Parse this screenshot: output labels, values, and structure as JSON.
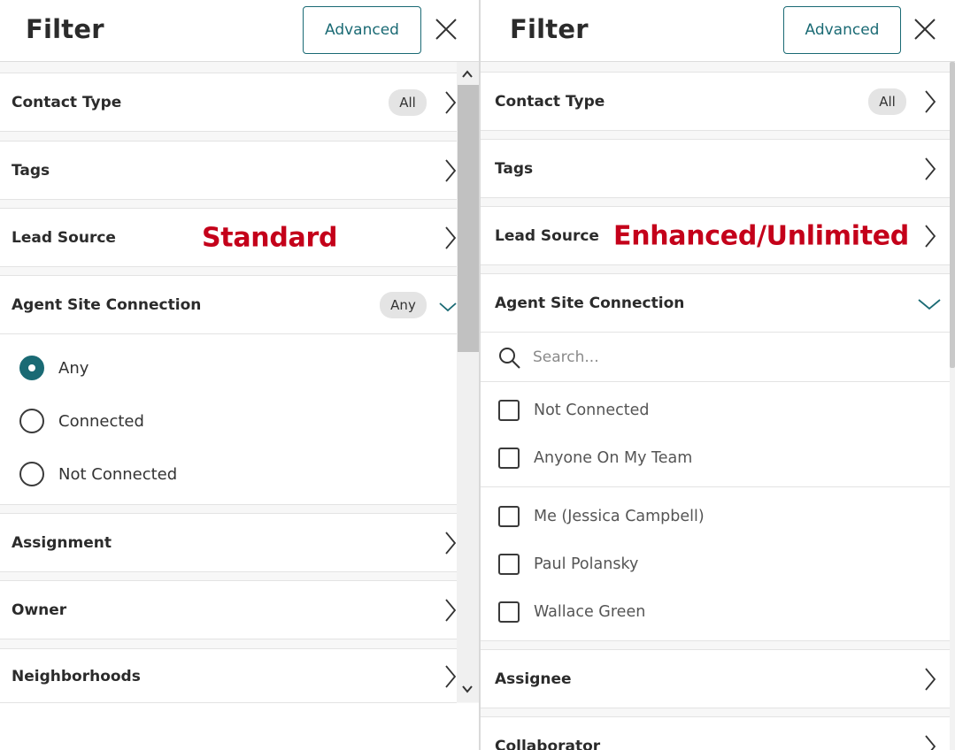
{
  "left_panel": {
    "title": "Filter",
    "advanced_label": "Advanced",
    "annotation": "Standard",
    "sections": {
      "contact_type": {
        "label": "Contact Type",
        "pill": "All"
      },
      "tags": {
        "label": "Tags"
      },
      "lead_source": {
        "label": "Lead Source"
      },
      "agent_site": {
        "label": "Agent Site Connection",
        "pill": "Any",
        "options": [
          {
            "label": "Any",
            "selected": true
          },
          {
            "label": "Connected",
            "selected": false
          },
          {
            "label": "Not Connected",
            "selected": false
          }
        ]
      },
      "assignment": {
        "label": "Assignment"
      },
      "owner": {
        "label": "Owner"
      },
      "neighborhoods": {
        "label": "Neighborhoods"
      }
    }
  },
  "right_panel": {
    "title": "Filter",
    "advanced_label": "Advanced",
    "annotation": "Enhanced/Unlimited",
    "sections": {
      "contact_type": {
        "label": "Contact Type",
        "pill": "All"
      },
      "tags": {
        "label": "Tags"
      },
      "lead_source": {
        "label": "Lead Source"
      },
      "agent_site": {
        "label": "Agent Site Connection",
        "search_placeholder": "Search...",
        "options": [
          {
            "label": "Not Connected",
            "checked": false
          },
          {
            "label": "Anyone On My Team",
            "checked": false
          },
          {
            "label": "Me (Jessica Campbell)",
            "checked": false
          },
          {
            "label": "Paul Polansky",
            "checked": false
          },
          {
            "label": "Wallace Green",
            "checked": false
          }
        ]
      },
      "assignee": {
        "label": "Assignee"
      },
      "collaborator": {
        "label": "Collaborator"
      }
    }
  },
  "colors": {
    "accent": "#1a6a74",
    "annotation": "#c4001a",
    "pill_bg": "#e4e4e4"
  }
}
